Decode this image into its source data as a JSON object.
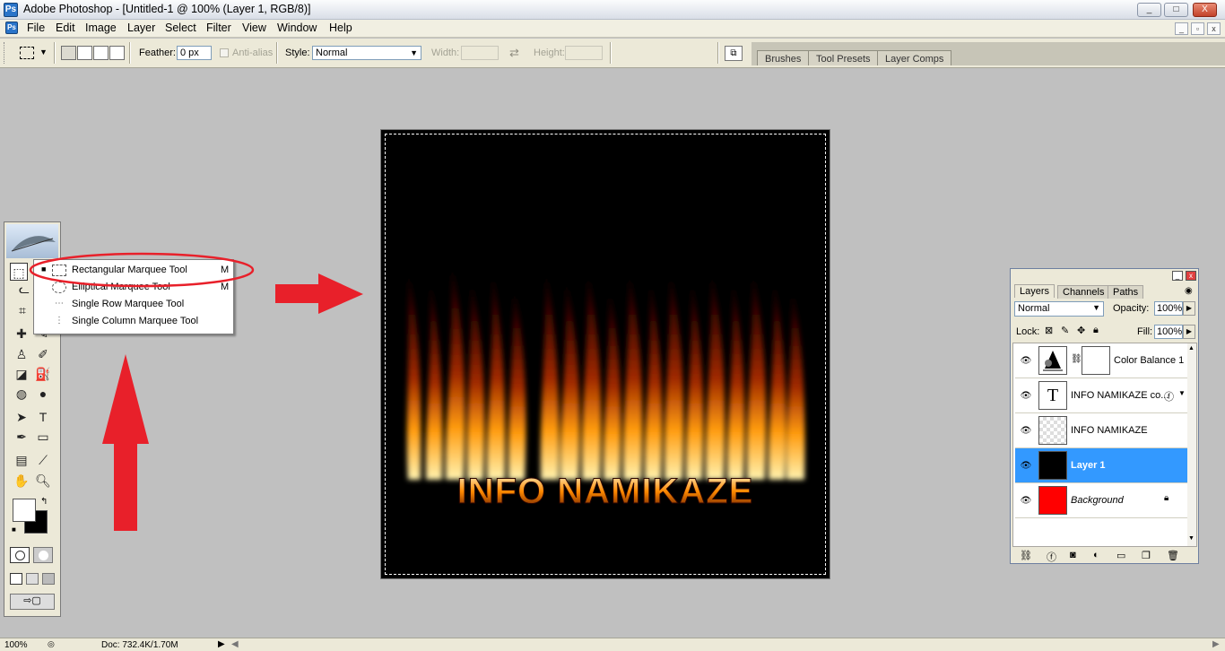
{
  "window": {
    "title": "Adobe Photoshop - [Untitled-1 @ 100% (Layer 1, RGB/8)]",
    "controls": [
      "_",
      "□",
      "X"
    ]
  },
  "menu": [
    "File",
    "Edit",
    "Image",
    "Layer",
    "Select",
    "Filter",
    "View",
    "Window",
    "Help"
  ],
  "options": {
    "feather_label": "Feather:",
    "feather_value": "0 px",
    "antialias_label": "Anti-alias",
    "style_label": "Style:",
    "style_value": "Normal",
    "width_label": "Width:",
    "height_label": "Height:"
  },
  "palette_well": [
    "Brushes",
    "Tool Presets",
    "Layer Comps"
  ],
  "flyout": [
    {
      "name": "Rectangular Marquee Tool",
      "key": "M",
      "icon": "rect-marquee-icon",
      "active": true
    },
    {
      "name": "Elliptical Marquee Tool",
      "key": "M",
      "icon": "ellipse-marquee-icon"
    },
    {
      "name": "Single Row Marquee Tool",
      "key": "",
      "icon": "row-marquee-icon"
    },
    {
      "name": "Single Column Marquee Tool",
      "key": "",
      "icon": "column-marquee-icon"
    }
  ],
  "canvas": {
    "text": "INFO NAMIKAZE",
    "background": "#000000",
    "fire_colors": [
      "#fff2a8",
      "#ffb21a",
      "#d64a00",
      "#5a0a00"
    ]
  },
  "layers_panel": {
    "tabs": [
      "Layers",
      "Channels",
      "Paths"
    ],
    "blend_mode": "Normal",
    "opacity_label": "Opacity:",
    "opacity": "100%",
    "lock_label": "Lock:",
    "fill_label": "Fill:",
    "fill": "100%",
    "layers": [
      {
        "name": "Color Balance 1",
        "type": "adjustment"
      },
      {
        "name": "INFO NAMIKAZE co...",
        "type": "text"
      },
      {
        "name": "INFO NAMIKAZE",
        "type": "pixel"
      },
      {
        "name": "Layer 1",
        "type": "fill-black",
        "selected": true
      },
      {
        "name": "Background",
        "type": "fill-red",
        "italic": true,
        "locked": true
      }
    ]
  },
  "status": {
    "zoom": "100%",
    "doc": "Doc: 732.4K/1.70M"
  },
  "colors": {
    "annotation_red": "#e8202a",
    "selection_blue": "#3399ff",
    "layer_red": "#ff0000"
  }
}
